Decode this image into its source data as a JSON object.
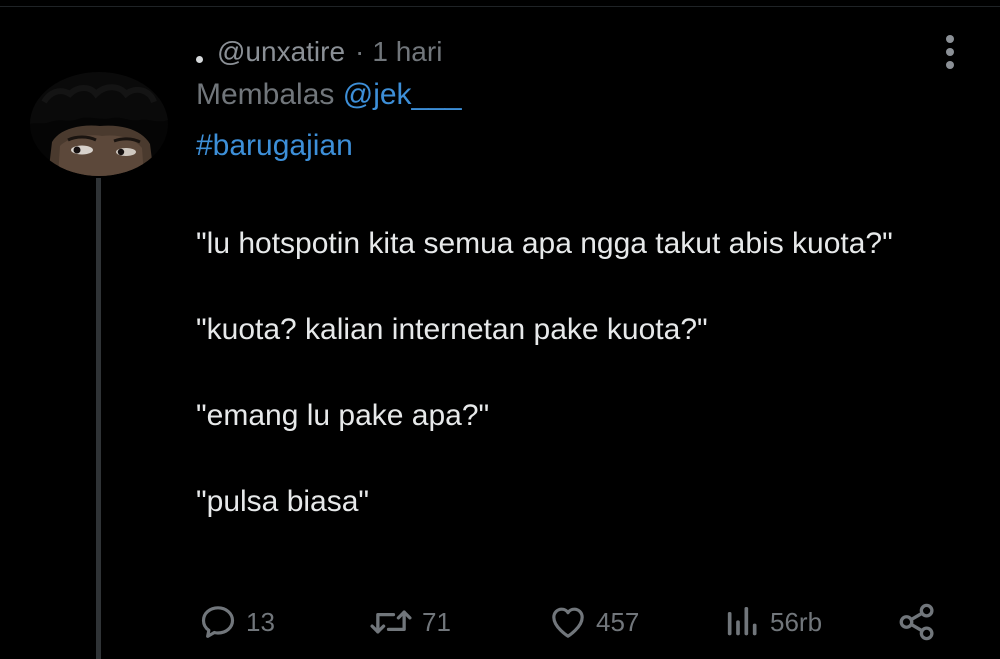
{
  "tweet": {
    "handle": "@unxatire",
    "separator": "·",
    "time": "1 hari",
    "reply_prefix": "Membalas",
    "reply_to": "@jek___",
    "hashtag": "#barugajian",
    "paragraphs": [
      "\"lu hotspotin kita semua apa ngga takut abis kuota?\"",
      "\"kuota? kalian internetan pake kuota?\"",
      "\"emang lu pake apa?\"",
      "\"pulsa biasa\""
    ]
  },
  "actions": {
    "replies": "13",
    "reposts": "71",
    "likes": "457",
    "views": "56rb"
  },
  "icons": {
    "more": "more-vertical-icon",
    "reply": "reply-icon",
    "repost": "repost-icon",
    "like": "heart-icon",
    "views": "views-icon",
    "share": "share-icon"
  },
  "colors": {
    "background": "#000000",
    "text": "#e7e9ea",
    "muted": "#71767b",
    "link": "#3d8fd8",
    "thread_line": "#2f3336"
  }
}
